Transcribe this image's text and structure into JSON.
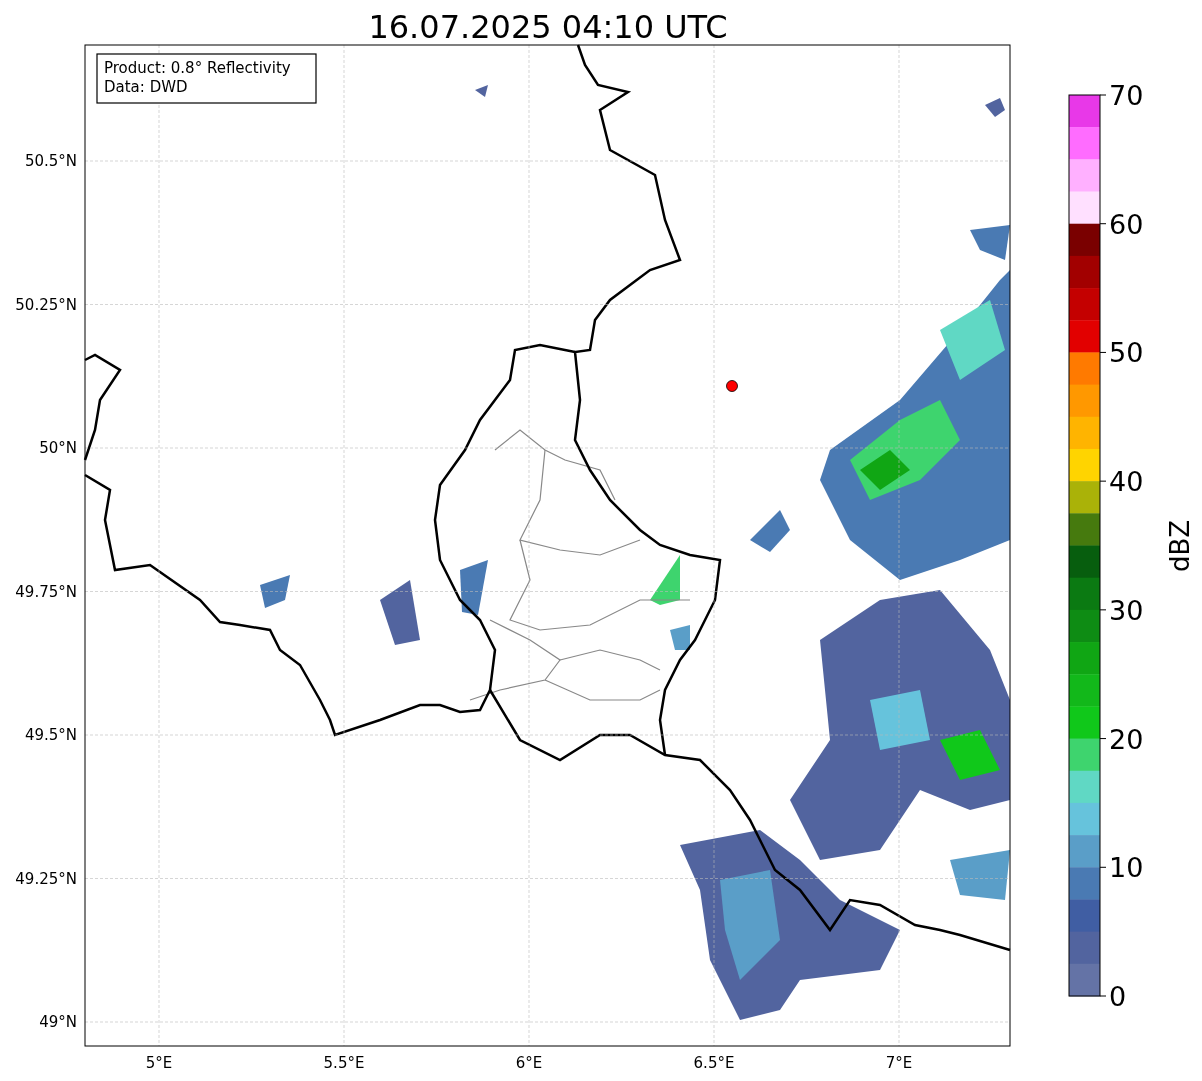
{
  "title": "16.07.2025 04:10 UTC",
  "info_box": {
    "lines": [
      "Product: 0.8° Reflectivity",
      "Data: DWD"
    ]
  },
  "map": {
    "x_ticks": [
      "5°E",
      "5.5°E",
      "6°E",
      "6.5°E",
      "7°E"
    ],
    "y_ticks": [
      "50.5°N",
      "50.25°N",
      "50°N",
      "49.75°N",
      "49.5°N",
      "49.25°N",
      "49°N"
    ]
  },
  "colorbar": {
    "label": "dBZ",
    "ticks": [
      "70",
      "60",
      "50",
      "40",
      "30",
      "20",
      "10",
      "0"
    ],
    "bins": [
      {
        "color": "#e838e8"
      },
      {
        "color": "#ff6cff"
      },
      {
        "color": "#ffb0ff"
      },
      {
        "color": "#ffe0ff"
      },
      {
        "color": "#7a0000"
      },
      {
        "color": "#a20000"
      },
      {
        "color": "#c40000"
      },
      {
        "color": "#e20000"
      },
      {
        "color": "#ff7a00"
      },
      {
        "color": "#ff9800"
      },
      {
        "color": "#ffb400"
      },
      {
        "color": "#ffd400"
      },
      {
        "color": "#aab208"
      },
      {
        "color": "#467a0e"
      },
      {
        "color": "#075e0e"
      },
      {
        "color": "#0b7a12"
      },
      {
        "color": "#0e8c14"
      },
      {
        "color": "#10a614"
      },
      {
        "color": "#12b81a"
      },
      {
        "color": "#10c81a"
      },
      {
        "color": "#3ed46e"
      },
      {
        "color": "#60d8c4"
      },
      {
        "color": "#66c3dc"
      },
      {
        "color": "#5a9ec8"
      },
      {
        "color": "#4a7ab3"
      },
      {
        "color": "#405ea3"
      },
      {
        "color": "#52649f"
      },
      {
        "color": "#6473a6"
      }
    ]
  }
}
